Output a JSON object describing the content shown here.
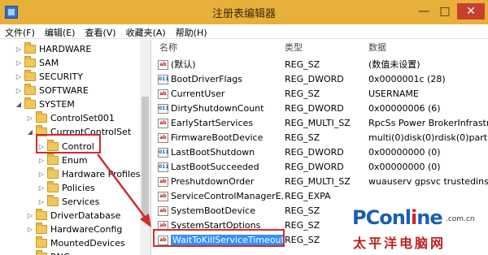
{
  "window": {
    "title": "注册表编辑器",
    "controls": {
      "minimize": "—",
      "maximize": "□",
      "close": "✕"
    }
  },
  "menu": [
    "文件(F)",
    "编辑(E)",
    "查看(V)",
    "收藏夹(A)",
    "帮助(H)"
  ],
  "tree": {
    "items": [
      {
        "label": "HARDWARE",
        "expander": "▷"
      },
      {
        "label": "SAM",
        "expander": "▷"
      },
      {
        "label": "SECURITY",
        "expander": "▷"
      },
      {
        "label": "SOFTWARE",
        "expander": "▷"
      },
      {
        "label": "SYSTEM",
        "expander": "◢"
      },
      {
        "label": "ControlSet001",
        "expander": "▷"
      },
      {
        "label": "CurrentControlSet",
        "expander": "◢"
      },
      {
        "label": "Control",
        "expander": "▷",
        "highlighted": true
      },
      {
        "label": "Enum",
        "expander": "▷"
      },
      {
        "label": "Hardware Profiles",
        "expander": "▷"
      },
      {
        "label": "Policies",
        "expander": "▷"
      },
      {
        "label": "Services",
        "expander": "▷"
      },
      {
        "label": "DriverDatabase",
        "expander": "▷"
      },
      {
        "label": "HardwareConfig",
        "expander": "▷"
      },
      {
        "label": "MountedDevices",
        "expander": ""
      },
      {
        "label": "RNG",
        "expander": ""
      }
    ]
  },
  "columns": {
    "name": "名称",
    "type": "类型",
    "data": "数据"
  },
  "values": [
    {
      "icon": "ab",
      "name": "(默认)",
      "type": "REG_SZ",
      "data": "(数值未设置)"
    },
    {
      "icon": "bin",
      "name": "BootDriverFlags",
      "type": "REG_DWORD",
      "data": "0x0000001c (28)"
    },
    {
      "icon": "ab",
      "name": "CurrentUser",
      "type": "REG_SZ",
      "data": "USERNAME"
    },
    {
      "icon": "bin",
      "name": "DirtyShutdownCount",
      "type": "REG_DWORD",
      "data": "0x00000006 (6)"
    },
    {
      "icon": "ab",
      "name": "EarlyStartServices",
      "type": "REG_MULTI_SZ",
      "data": "RpcSs Power BrokerInfrastru"
    },
    {
      "icon": "ab",
      "name": "FirmwareBootDevice",
      "type": "REG_SZ",
      "data": "multi(0)disk(0)rdisk(0)partitio"
    },
    {
      "icon": "bin",
      "name": "LastBootShutdown",
      "type": "REG_DWORD",
      "data": "0x00000000 (0)"
    },
    {
      "icon": "bin",
      "name": "LastBootSucceeded",
      "type": "REG_DWORD",
      "data": "0x00000000 (0)"
    },
    {
      "icon": "ab",
      "name": "PreshutdownOrder",
      "type": "REG_MULTI_SZ",
      "data": "wuauserv gpsvc trustedinstal"
    },
    {
      "icon": "ab",
      "name": "ServiceControlManagerE...",
      "type": "REG_EXPA",
      "data": ""
    },
    {
      "icon": "ab",
      "name": "SystemBootDevice",
      "type": "REG_SZ",
      "data": ""
    },
    {
      "icon": "ab",
      "name": "SystemStartOptions",
      "type": "REG_SZ",
      "data": ""
    },
    {
      "icon": "ab",
      "name": "WaitToKillServiceTimeout",
      "type": "REG_SZ",
      "data": "",
      "selected": true
    }
  ],
  "watermark": {
    "logo_main": "PConl",
    "logo_accent": "i",
    "logo_tail": "ne",
    "domain": ".com.cn",
    "subtitle": "太平洋电脑网"
  },
  "colors": {
    "titlebar": "#e8b03a",
    "highlight": "#d42b2b",
    "selection": "#3390ff"
  }
}
